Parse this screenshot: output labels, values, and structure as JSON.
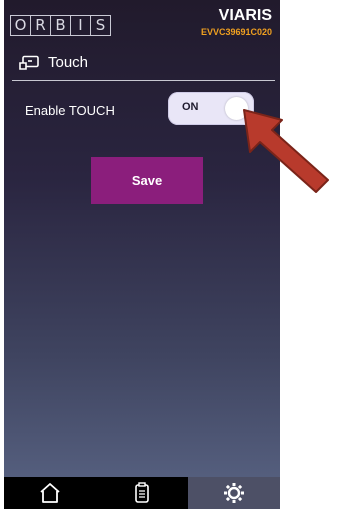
{
  "header": {
    "logo_letters": [
      "O",
      "R",
      "B",
      "I",
      "S"
    ],
    "brand": "VIARIS",
    "serial": "EVVC39691C020"
  },
  "section": {
    "title": "Touch",
    "icon": "touch-hand-icon"
  },
  "settings": {
    "enable_touch_label": "Enable TOUCH",
    "toggle_state": "ON"
  },
  "actions": {
    "save_label": "Save"
  },
  "nav": {
    "items": [
      {
        "icon": "home-icon",
        "active": false
      },
      {
        "icon": "document-icon",
        "active": false
      },
      {
        "icon": "settings-gear-icon",
        "active": true
      }
    ]
  },
  "colors": {
    "accent_orange": "#f0a020",
    "save_button": "#8b1e7c",
    "arrow": "#b83a2c"
  }
}
